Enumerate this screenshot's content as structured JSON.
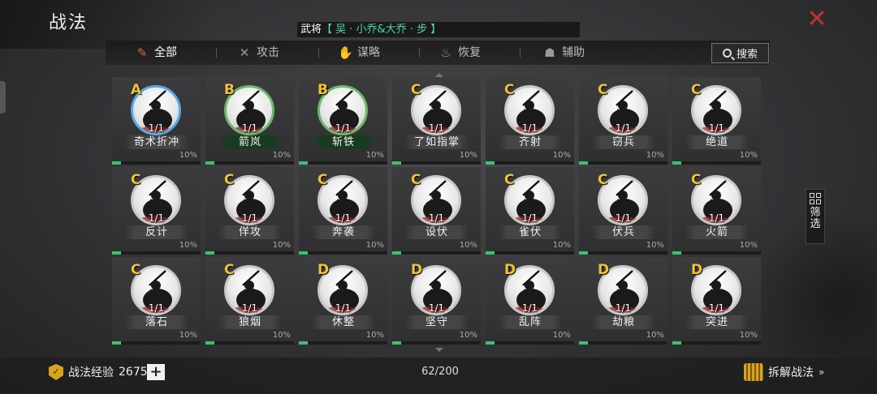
{
  "header": {
    "title": "战法",
    "hero_prefix": "武将",
    "hero_name": "【 吴 · 小乔&大乔 · 步 】",
    "close_label": "✕"
  },
  "tabs": [
    {
      "label": "全部",
      "icon": "scroll-icon",
      "glyph": "✎",
      "active": true
    },
    {
      "label": "攻击",
      "icon": "crossed-swords-icon",
      "glyph": "✕",
      "active": false
    },
    {
      "label": "谋略",
      "icon": "hand-icon",
      "glyph": "✋",
      "active": false
    },
    {
      "label": "恢复",
      "icon": "pot-icon",
      "glyph": "♨",
      "active": false
    },
    {
      "label": "辅助",
      "icon": "bag-icon",
      "glyph": "☗",
      "active": false
    }
  ],
  "search_label": "搜索",
  "filter_label": "筛选",
  "skills": [
    {
      "grade": "A",
      "name": "奇术折冲",
      "count": "1/1",
      "pct": "10%",
      "progress": 0.1
    },
    {
      "grade": "B",
      "name": "箭岚",
      "count": "1/1",
      "pct": "10%",
      "progress": 0.1
    },
    {
      "grade": "B",
      "name": "斩铁",
      "count": "1/1",
      "pct": "10%",
      "progress": 0.1
    },
    {
      "grade": "C",
      "name": "了如指掌",
      "count": "1/1",
      "pct": "10%",
      "progress": 0.1
    },
    {
      "grade": "C",
      "name": "齐射",
      "count": "1/1",
      "pct": "10%",
      "progress": 0.1
    },
    {
      "grade": "C",
      "name": "窃兵",
      "count": "1/1",
      "pct": "10%",
      "progress": 0.1
    },
    {
      "grade": "C",
      "name": "绝道",
      "count": "1/1",
      "pct": "10%",
      "progress": 0.1
    },
    {
      "grade": "C",
      "name": "反计",
      "count": "1/1",
      "pct": "10%",
      "progress": 0.1
    },
    {
      "grade": "C",
      "name": "佯攻",
      "count": "1/1",
      "pct": "10%",
      "progress": 0.1
    },
    {
      "grade": "C",
      "name": "奔袭",
      "count": "1/1",
      "pct": "10%",
      "progress": 0.1
    },
    {
      "grade": "C",
      "name": "设伏",
      "count": "1/1",
      "pct": "10%",
      "progress": 0.1
    },
    {
      "grade": "C",
      "name": "雀伏",
      "count": "1/1",
      "pct": "10%",
      "progress": 0.1
    },
    {
      "grade": "C",
      "name": "伏兵",
      "count": "1/1",
      "pct": "10%",
      "progress": 0.1
    },
    {
      "grade": "C",
      "name": "火箭",
      "count": "1/1",
      "pct": "10%",
      "progress": 0.1
    },
    {
      "grade": "C",
      "name": "落石",
      "count": "1/1",
      "pct": "10%",
      "progress": 0.1
    },
    {
      "grade": "C",
      "name": "狼烟",
      "count": "1/1",
      "pct": "10%",
      "progress": 0.1
    },
    {
      "grade": "D",
      "name": "休整",
      "count": "1/1",
      "pct": "10%",
      "progress": 0.1
    },
    {
      "grade": "D",
      "name": "坚守",
      "count": "1/1",
      "pct": "10%",
      "progress": 0.1
    },
    {
      "grade": "D",
      "name": "乱阵",
      "count": "1/1",
      "pct": "10%",
      "progress": 0.1
    },
    {
      "grade": "D",
      "name": "劫粮",
      "count": "1/1",
      "pct": "10%",
      "progress": 0.1
    },
    {
      "grade": "D",
      "name": "突进",
      "count": "1/1",
      "pct": "10%",
      "progress": 0.1
    }
  ],
  "footer": {
    "exp_label": "战法经验",
    "exp_value": "2675",
    "plus_label": "+",
    "capacity": "62/200",
    "decompose_label": "拆解战法",
    "decompose_arrow": "»"
  },
  "colors": {
    "accent_red": "#c0352b",
    "grade_gold": "#f1c232",
    "ring_A": "#5aa7e8",
    "ring_B": "#6bb86b",
    "progress_green": "#3fbf6f",
    "hero_green": "#4fd7a0"
  }
}
